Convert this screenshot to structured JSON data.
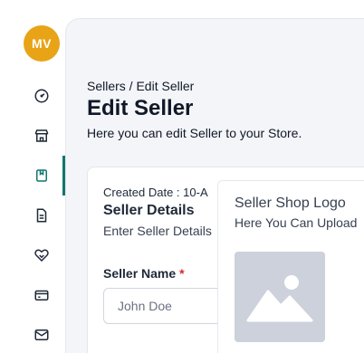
{
  "user": {
    "initials": "MV"
  },
  "sidebar": {
    "items": [
      {
        "icon": "dashboard-icon"
      },
      {
        "icon": "store-icon"
      },
      {
        "icon": "book-icon",
        "active": true
      },
      {
        "icon": "document-icon"
      },
      {
        "icon": "handshake-icon"
      },
      {
        "icon": "credit-card-icon"
      },
      {
        "icon": "mail-icon"
      }
    ],
    "accent": "#0f766e"
  },
  "header": {
    "breadcrumb": "Sellers / Edit Seller",
    "title": "Edit Seller",
    "subtitle": "Here you can edit Seller to your Store."
  },
  "seller_details": {
    "created_date_label": "Created Date : 10-A",
    "title": "Seller Details",
    "subtitle": "Enter Seller Details",
    "name_label": "Seller Name",
    "required_mark": "*",
    "name_placeholder": "John Doe"
  },
  "logo_panel": {
    "title": "Seller Shop Logo",
    "subtitle": "Here You Can Upload",
    "image_icon": "image-placeholder-icon"
  },
  "colors": {
    "avatar": "#e8a317",
    "required": "#dc2626",
    "placeholder_bg": "#ccd1dc"
  }
}
